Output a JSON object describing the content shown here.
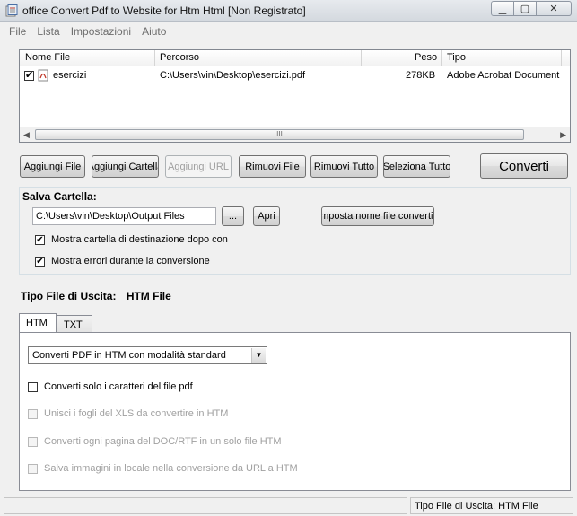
{
  "window": {
    "title": "office Convert Pdf to Website for Htm Html [Non Registrato]",
    "controls": [
      "minimize-icon",
      "maximize-icon",
      "close-icon"
    ]
  },
  "menu": {
    "items": [
      "File",
      "Lista",
      "Impostazioni",
      "Aiuto"
    ]
  },
  "file_list": {
    "columns": [
      "Nome File",
      "Percorso",
      "Peso",
      "Tipo"
    ],
    "rows": [
      {
        "checked": true,
        "name": "esercizi",
        "path": "C:\\Users\\vin\\Desktop\\esercizi.pdf",
        "size": "278KB",
        "type": "Adobe Acrobat Document"
      }
    ],
    "scroll_thumb_grip": "III"
  },
  "toolbar": {
    "add_file": "Aggiungi File",
    "add_folder": "Aggiungi Cartella",
    "add_url": "Aggiungi URL",
    "remove_file": "Rimuovi File",
    "remove_all": "Rimuovi Tutto",
    "select_all": "Seleziona Tutto",
    "convert": "Converti"
  },
  "save_folder": {
    "label": "Salva Cartella:",
    "path": "C:\\Users\\vin\\Desktop\\Output Files",
    "browse": "...",
    "open": "Apri",
    "set_name": "Imposta nome file convertiti",
    "show_dest": {
      "checked": true,
      "label": "Mostra cartella di destinazione dopo con"
    },
    "show_errors": {
      "checked": true,
      "label": "Mostra errori durante la conversione"
    }
  },
  "output_type": {
    "label": "Tipo File di Uscita:",
    "value": "HTM File"
  },
  "tabs": [
    "HTM",
    "TXT"
  ],
  "htm_options": {
    "mode_select": "Converti PDF in HTM con modalità standard",
    "only_chars": {
      "checked": false,
      "label": "Converti solo i caratteri del file pdf"
    },
    "merge_xls": {
      "checked": false,
      "label": "Unisci i fogli del XLS da convertire in HTM"
    },
    "doc_pages": {
      "checked": false,
      "label": "Converti ogni pagina del DOC/RTF in un solo file HTM"
    },
    "save_images": {
      "checked": false,
      "label": "Salva immagini in locale nella conversione da URL a HTM"
    }
  },
  "status": {
    "left": "",
    "right": "Tipo File di Uscita:  HTM File"
  }
}
